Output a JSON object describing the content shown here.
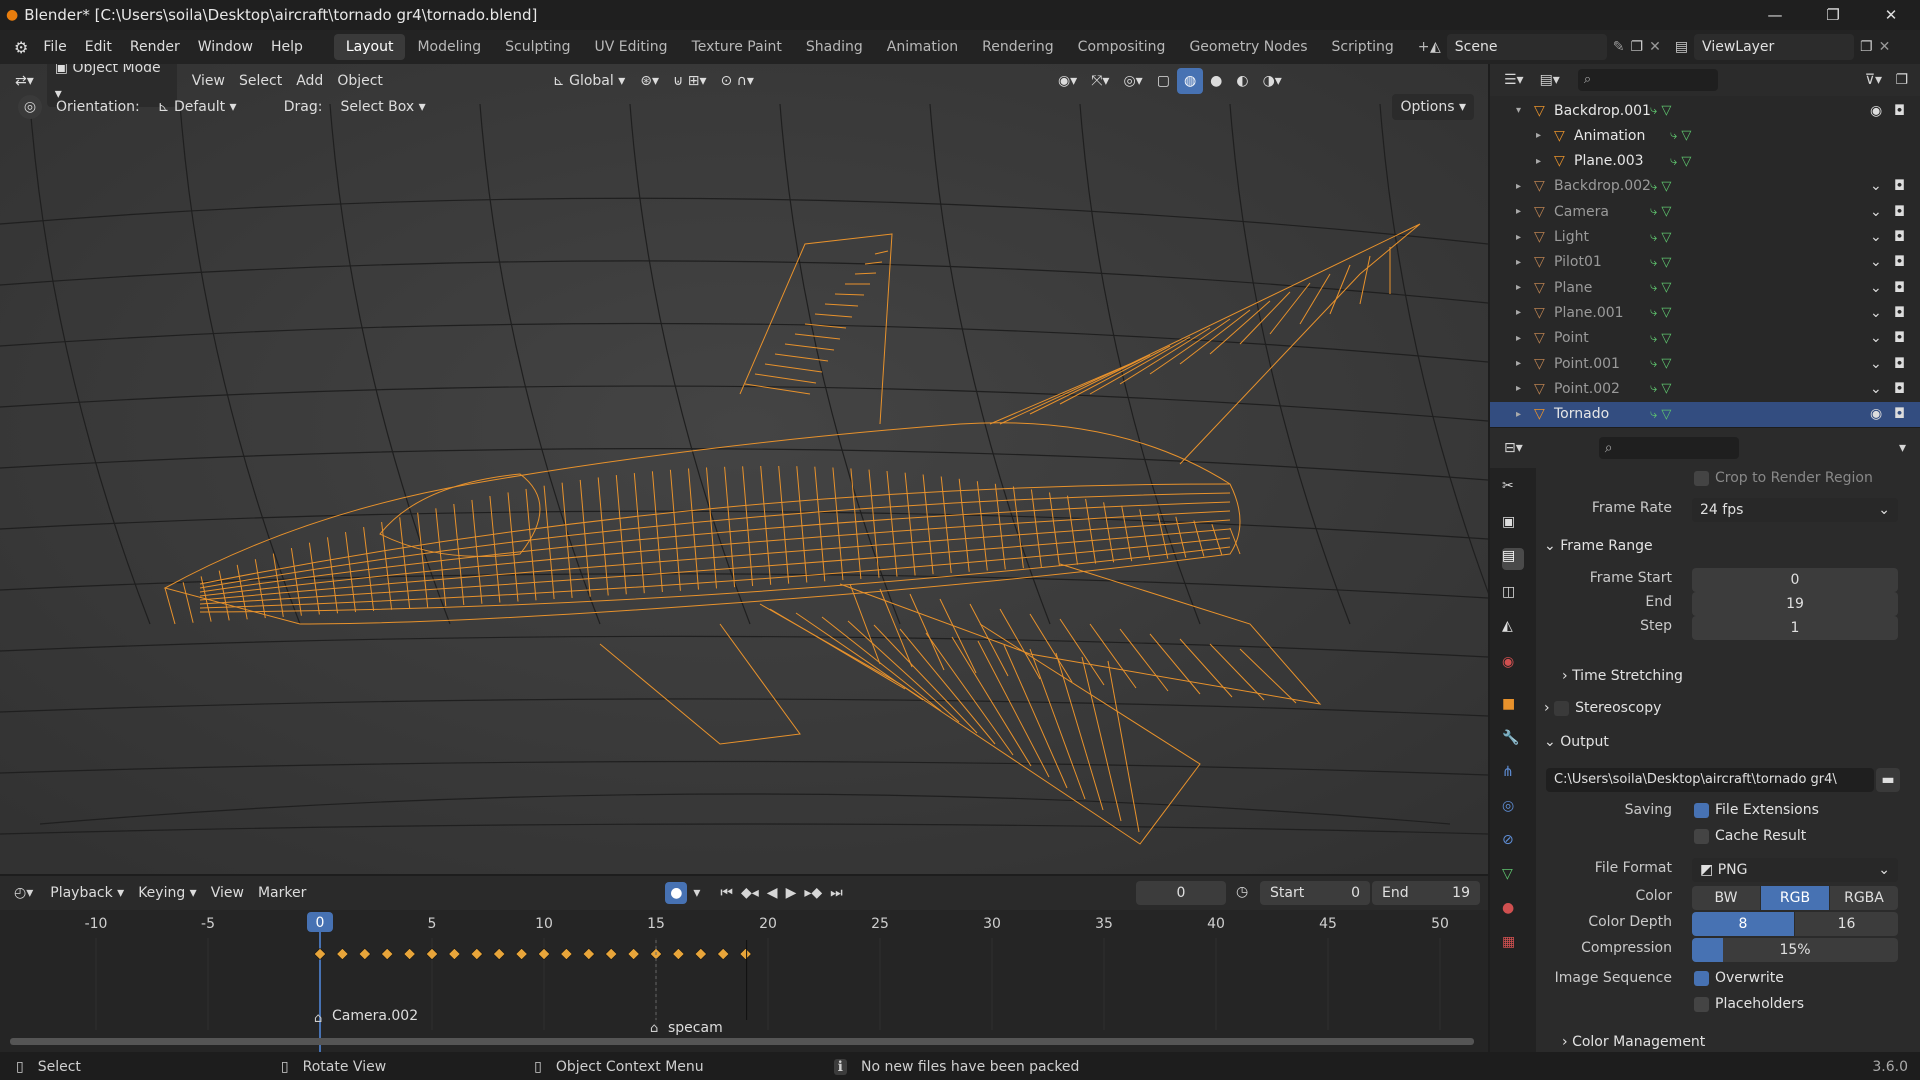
{
  "window": {
    "title": "Blender* [C:\\Users\\soila\\Desktop\\aircraft\\tornado gr4\\tornado.blend]"
  },
  "menu": [
    "File",
    "Edit",
    "Render",
    "Window",
    "Help"
  ],
  "workspaces": [
    "Layout",
    "Modeling",
    "Sculpting",
    "UV Editing",
    "Texture Paint",
    "Shading",
    "Animation",
    "Rendering",
    "Compositing",
    "Geometry Nodes",
    "Scripting"
  ],
  "active_workspace": "Layout",
  "scene": {
    "name": "Scene",
    "view_layer": "ViewLayer"
  },
  "viewport": {
    "mode": "Object Mode",
    "menu": [
      "View",
      "Select",
      "Add",
      "Object"
    ],
    "transform": "Global",
    "orientation_label": "Orientation:",
    "orientation": "Default",
    "drag_label": "Drag:",
    "drag": "Select Box",
    "options": "Options"
  },
  "outliner": {
    "items": [
      {
        "name": "Backdrop.001",
        "level": 0,
        "expanded": true,
        "visible": true
      },
      {
        "name": "Animation",
        "level": 1
      },
      {
        "name": "Plane.003",
        "level": 1
      },
      {
        "name": "Backdrop.002",
        "level": 0,
        "dim": true
      },
      {
        "name": "Camera",
        "level": 0,
        "dim": true
      },
      {
        "name": "Light",
        "level": 0,
        "dim": true
      },
      {
        "name": "Pilot01",
        "level": 0,
        "dim": true
      },
      {
        "name": "Plane",
        "level": 0,
        "dim": true
      },
      {
        "name": "Plane.001",
        "level": 0,
        "dim": true
      },
      {
        "name": "Point",
        "level": 0,
        "dim": true
      },
      {
        "name": "Point.001",
        "level": 0,
        "dim": true
      },
      {
        "name": "Point.002",
        "level": 0,
        "dim": true
      },
      {
        "name": "Tornado",
        "level": 0,
        "selected": true
      }
    ]
  },
  "properties": {
    "crop_label": "Crop to Render Region",
    "frame_rate_label": "Frame Rate",
    "frame_rate": "24 fps",
    "frame_range_title": "Frame Range",
    "frame_start_label": "Frame Start",
    "frame_start": "0",
    "end_label": "End",
    "end": "19",
    "step_label": "Step",
    "step": "1",
    "time_stretching": "Time Stretching",
    "stereoscopy": "Stereoscopy",
    "output_title": "Output",
    "output_path": "C:\\Users\\soila\\Desktop\\aircraft\\tornado gr4\\",
    "saving_label": "Saving",
    "file_extensions": "File Extensions",
    "cache_result": "Cache Result",
    "file_format_label": "File Format",
    "file_format": "PNG",
    "color_label": "Color",
    "color_options": [
      "BW",
      "RGB",
      "RGBA"
    ],
    "color_selected": "RGB",
    "color_depth_label": "Color Depth",
    "color_depth_options": [
      "8",
      "16"
    ],
    "color_depth_selected": "8",
    "compression_label": "Compression",
    "compression": "15%",
    "compression_value": 0.15,
    "image_sequence_label": "Image Sequence",
    "overwrite": "Overwrite",
    "placeholders": "Placeholders",
    "color_management": "Color Management"
  },
  "timeline": {
    "menu": [
      "Playback",
      "Keying",
      "View",
      "Marker"
    ],
    "current_frame": "0",
    "start_label": "Start",
    "start": "0",
    "end_label": "End",
    "end": "19",
    "ticks": [
      "-10",
      "-5",
      "0",
      "5",
      "10",
      "15",
      "20",
      "25",
      "30",
      "35",
      "40",
      "45",
      "50"
    ],
    "markers": [
      "Camera.002",
      "specam"
    ]
  },
  "status": {
    "select": "Select",
    "rotate": "Rotate View",
    "context": "Object Context Menu",
    "message": "No new files have been packed",
    "version": "3.6.0"
  },
  "colors": {
    "accent": "#4772b3",
    "wire": "#e8922c",
    "keyframe": "#e8a53a",
    "selected_row": "#334d80"
  }
}
